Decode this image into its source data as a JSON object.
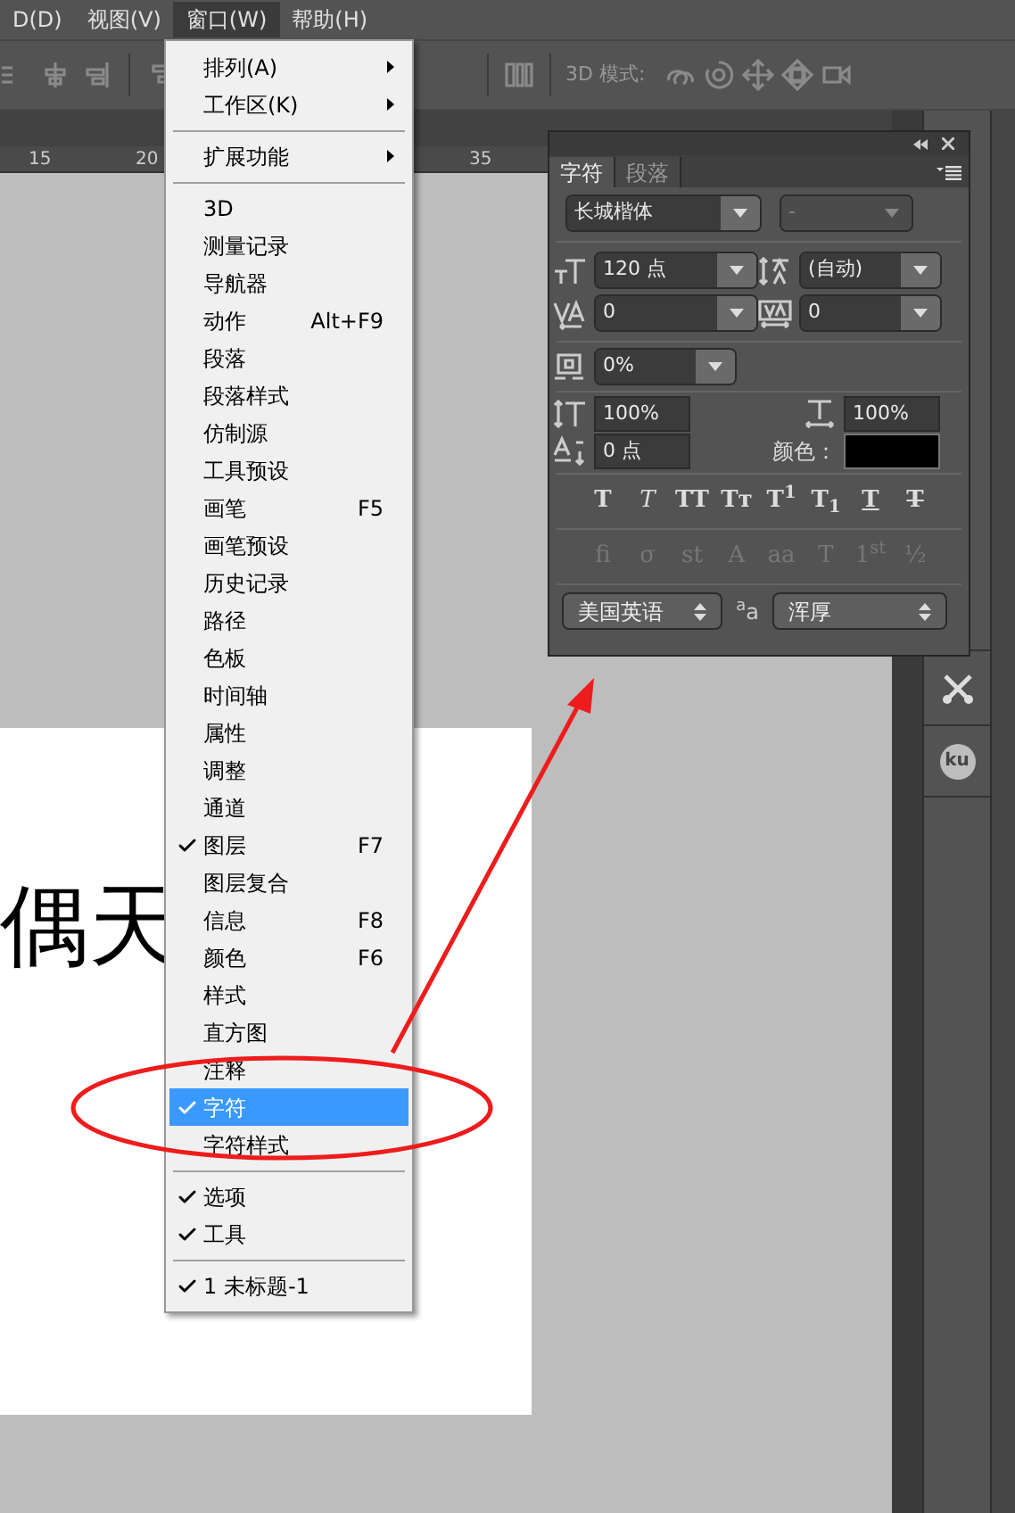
{
  "menubar": [
    {
      "label": "D(D)",
      "selected": false
    },
    {
      "label": "视图(V)",
      "selected": false
    },
    {
      "label": "窗口(W)",
      "selected": true
    },
    {
      "label": "帮助(H)",
      "selected": false
    }
  ],
  "options_bar": {
    "mode_label": "3D 模式:"
  },
  "ruler": {
    "ticks": [
      {
        "label": "15"
      },
      {
        "label": "20"
      },
      {
        "label": "35"
      }
    ]
  },
  "document": {
    "text": "偶天"
  },
  "menu": {
    "items": [
      {
        "kind": "item",
        "label": "排列(A)",
        "submenu": true,
        "checked": false,
        "selected": false
      },
      {
        "kind": "item",
        "label": "工作区(K)",
        "submenu": true,
        "checked": false,
        "selected": false
      },
      {
        "kind": "separator"
      },
      {
        "kind": "item",
        "label": "扩展功能",
        "submenu": true,
        "checked": false,
        "selected": false
      },
      {
        "kind": "separator"
      },
      {
        "kind": "item",
        "label": "3D",
        "checked": false,
        "selected": false
      },
      {
        "kind": "item",
        "label": "测量记录",
        "checked": false,
        "selected": false
      },
      {
        "kind": "item",
        "label": "导航器",
        "checked": false,
        "selected": false
      },
      {
        "kind": "item",
        "label": "动作",
        "shortcut": "Alt+F9",
        "checked": false,
        "selected": false
      },
      {
        "kind": "item",
        "label": "段落",
        "checked": false,
        "selected": false
      },
      {
        "kind": "item",
        "label": "段落样式",
        "checked": false,
        "selected": false
      },
      {
        "kind": "item",
        "label": "仿制源",
        "checked": false,
        "selected": false
      },
      {
        "kind": "item",
        "label": "工具预设",
        "checked": false,
        "selected": false
      },
      {
        "kind": "item",
        "label": "画笔",
        "shortcut": "F5",
        "checked": false,
        "selected": false
      },
      {
        "kind": "item",
        "label": "画笔预设",
        "checked": false,
        "selected": false
      },
      {
        "kind": "item",
        "label": "历史记录",
        "checked": false,
        "selected": false
      },
      {
        "kind": "item",
        "label": "路径",
        "checked": false,
        "selected": false
      },
      {
        "kind": "item",
        "label": "色板",
        "checked": false,
        "selected": false
      },
      {
        "kind": "item",
        "label": "时间轴",
        "checked": false,
        "selected": false
      },
      {
        "kind": "item",
        "label": "属性",
        "checked": false,
        "selected": false
      },
      {
        "kind": "item",
        "label": "调整",
        "checked": false,
        "selected": false
      },
      {
        "kind": "item",
        "label": "通道",
        "checked": false,
        "selected": false
      },
      {
        "kind": "item",
        "label": "图层",
        "shortcut": "F7",
        "checked": true,
        "selected": false
      },
      {
        "kind": "item",
        "label": "图层复合",
        "checked": false,
        "selected": false
      },
      {
        "kind": "item",
        "label": "信息",
        "shortcut": "F8",
        "checked": false,
        "selected": false
      },
      {
        "kind": "item",
        "label": "颜色",
        "shortcut": "F6",
        "checked": false,
        "selected": false
      },
      {
        "kind": "item",
        "label": "样式",
        "checked": false,
        "selected": false
      },
      {
        "kind": "item",
        "label": "直方图",
        "checked": false,
        "selected": false
      },
      {
        "kind": "item",
        "label": "注释",
        "checked": false,
        "selected": false
      },
      {
        "kind": "item",
        "label": "字符",
        "checked": true,
        "selected": true
      },
      {
        "kind": "item",
        "label": "字符样式",
        "checked": false,
        "selected": false
      },
      {
        "kind": "separator"
      },
      {
        "kind": "item",
        "label": "选项",
        "checked": true,
        "selected": false
      },
      {
        "kind": "item",
        "label": "工具",
        "checked": true,
        "selected": false
      },
      {
        "kind": "separator"
      },
      {
        "kind": "item",
        "label": "1 未标题-1",
        "checked": true,
        "selected": false
      }
    ]
  },
  "char_panel": {
    "tabs": [
      {
        "label": "字符",
        "selected": true
      },
      {
        "label": "段落",
        "selected": false
      }
    ],
    "font_family": "长城楷体",
    "font_style": "-",
    "size": "120 点",
    "leading": "(自动)",
    "kerning": "0",
    "tracking": "0",
    "tsume": "0%",
    "vertical_scale": "100%",
    "horizontal_scale": "100%",
    "baseline_shift": "0 点",
    "color_label": "颜色：",
    "color": "#000000",
    "style_buttons": [
      {
        "label": "T",
        "kind": "bold"
      },
      {
        "label": "T",
        "kind": "italic"
      },
      {
        "label": "TT",
        "kind": "caps"
      },
      {
        "label": "Tᴛ",
        "kind": "smallcaps"
      },
      {
        "label": "T$^{1}$",
        "kind": "super"
      },
      {
        "label": "T$_{1}$",
        "kind": "sub"
      },
      {
        "label": "T",
        "kind": "underline"
      },
      {
        "label": "T",
        "kind": "strike"
      }
    ],
    "opentype_buttons": [
      {
        "label": "fi",
        "disabled": true
      },
      {
        "label": "σ",
        "disabled": true
      },
      {
        "label": "st",
        "disabled": true
      },
      {
        "label": "A",
        "disabled": true
      },
      {
        "label": "aa",
        "disabled": true
      },
      {
        "label": "T",
        "disabled": true
      },
      {
        "label": "1$^{st}$",
        "disabled": true
      },
      {
        "label": "½",
        "disabled": true
      }
    ],
    "language": "美国英语",
    "antialias_label": "$^{a}$a",
    "antialias": "浑厚"
  },
  "dock": {
    "badge": "ku"
  }
}
